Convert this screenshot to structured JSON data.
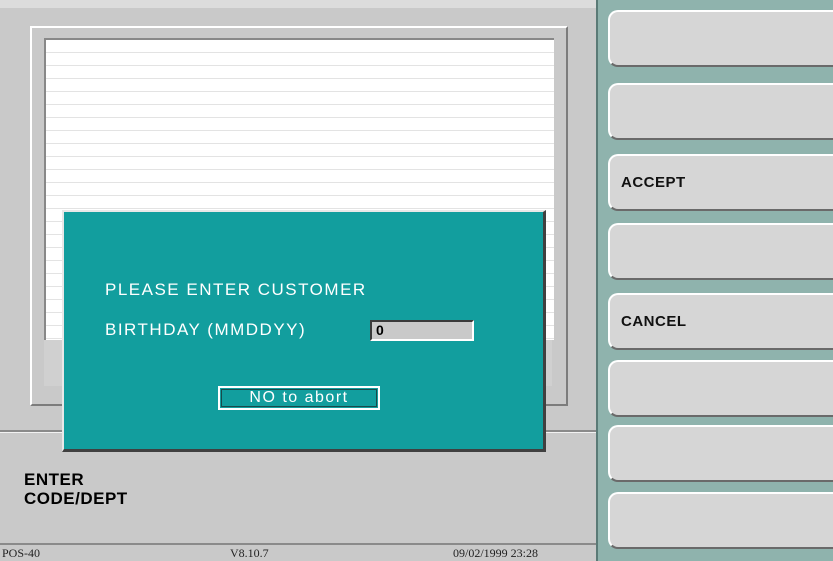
{
  "prompt": {
    "line1": "ENTER",
    "line2": "CODE/DEPT"
  },
  "status_bar": {
    "model": "POS-40",
    "version": "V8.10.7",
    "datetime": "09/02/1999 23:28"
  },
  "function_keys": [
    {
      "label": ""
    },
    {
      "label": ""
    },
    {
      "label": "ACCEPT"
    },
    {
      "label": ""
    },
    {
      "label": "CANCEL"
    },
    {
      "label": ""
    },
    {
      "label": ""
    },
    {
      "label": ""
    }
  ],
  "dialog": {
    "line1": "PLEASE ENTER CUSTOMER",
    "line2": "BIRTHDAY (MMDDYY)",
    "input_value": "0",
    "abort_label": "NO to abort"
  },
  "colors": {
    "dialog_bg": "#129e9e",
    "panel_bg": "#8fb3ad",
    "screen_bg": "#c9c9c9"
  }
}
